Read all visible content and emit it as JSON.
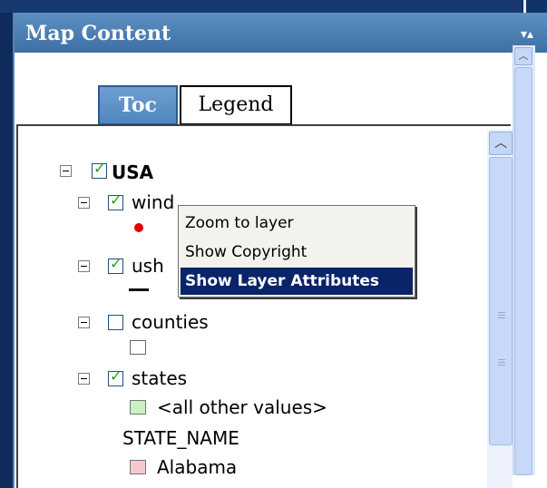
{
  "panel": {
    "title": "Map Content",
    "collapse_glyph": "▾▴"
  },
  "tabs": [
    {
      "label": "Toc",
      "active": true
    },
    {
      "label": "Legend",
      "active": false
    }
  ],
  "scrollbars": {
    "up_glyph": "︿"
  },
  "tree": {
    "root": {
      "label": "USA",
      "checked": true
    },
    "layers": [
      {
        "label": "wind",
        "checked": true,
        "symbol": "red-point-icon"
      },
      {
        "label": "ush",
        "checked": true,
        "symbol": "black-line-icon"
      },
      {
        "label": "counties",
        "checked": false,
        "symbol": "empty-box-icon"
      },
      {
        "label": "states",
        "checked": true
      }
    ],
    "states_legend": {
      "other_label": "<all other values>",
      "field_label": "STATE_NAME",
      "first_value_label": "Alabama"
    }
  },
  "context_menu": {
    "items": [
      {
        "label": "Zoom to layer",
        "selected": false
      },
      {
        "label": "Show Copyright",
        "selected": false
      },
      {
        "label": "Show Layer Attributes",
        "selected": true
      }
    ]
  },
  "colors": {
    "title_bar": "#4f80b6",
    "selection": "#0a246a",
    "check": "#21a121",
    "wind_symbol": "#e00000",
    "other_values_fill": "#c8f0c0",
    "alabama_fill": "#f5c8cc"
  }
}
